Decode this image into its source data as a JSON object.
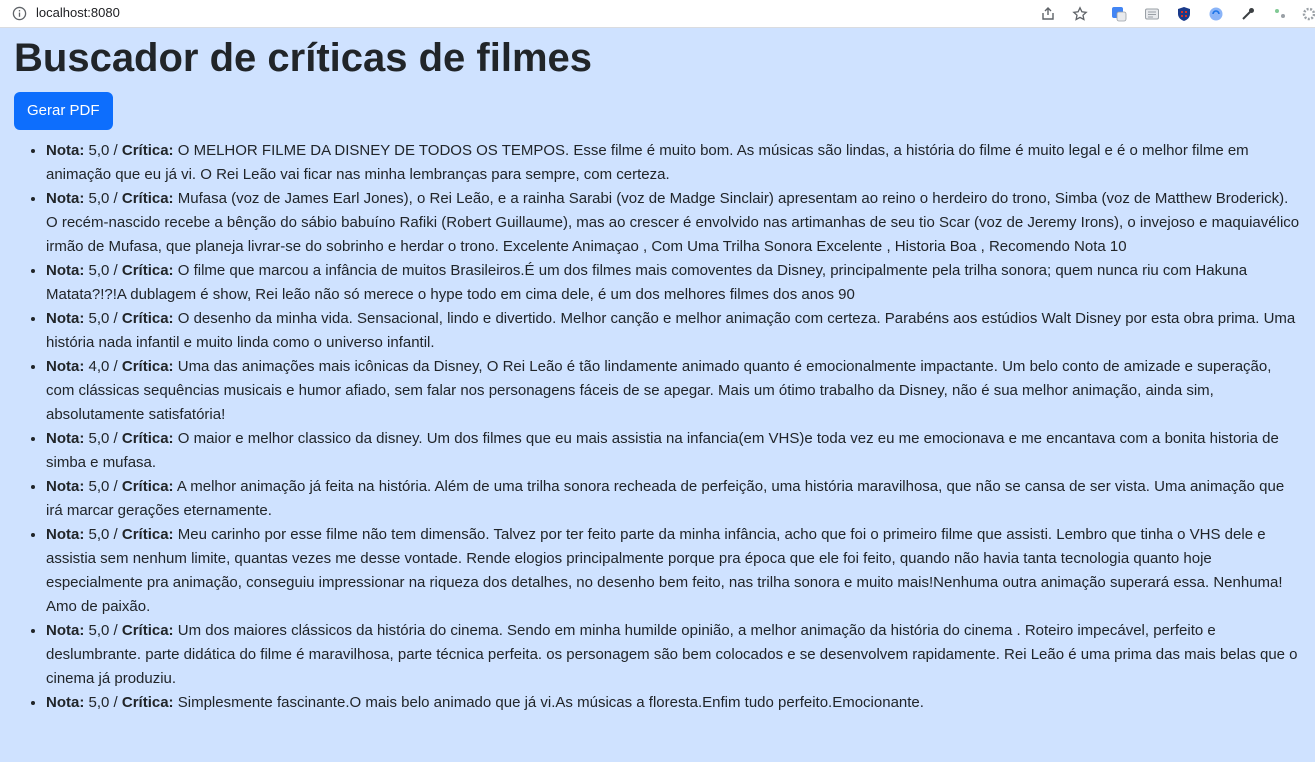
{
  "browser": {
    "url": "localhost:8080"
  },
  "page": {
    "title": "Buscador de críticas de filmes",
    "pdf_button_label": "Gerar PDF"
  },
  "labels": {
    "nota": "Nota:",
    "critica": "Crítica:",
    "separator": " / "
  },
  "reviews": [
    {
      "nota": "5,0",
      "critica": "O MELHOR FILME DA DISNEY DE TODOS OS TEMPOS. Esse filme é muito bom. As músicas são lindas, a história do filme é muito legal e é o melhor filme em animação que eu já vi. O Rei Leão vai ficar nas minha lembranças para sempre, com certeza."
    },
    {
      "nota": "5,0",
      "critica": "Mufasa (voz de James Earl Jones), o Rei Leão, e a rainha Sarabi (voz de Madge Sinclair) apresentam ao reino o herdeiro do trono, Simba (voz de Matthew Broderick). O recém-nascido recebe a bênção do sábio babuíno Rafiki (Robert Guillaume), mas ao crescer é envolvido nas artimanhas de seu tio Scar (voz de Jeremy Irons), o invejoso e maquiavélico irmão de Mufasa, que planeja livrar-se do sobrinho e herdar o trono. Excelente Animaçao , Com Uma Trilha Sonora Excelente , Historia Boa , Recomendo Nota 10"
    },
    {
      "nota": "5,0",
      "critica": "O filme que marcou a infância de muitos Brasileiros.É um dos filmes mais comoventes da Disney, principalmente pela trilha sonora; quem nunca riu com Hakuna Matata?!?!A dublagem é show, Rei leão não só merece o hype todo em cima dele, é um dos melhores filmes dos anos 90"
    },
    {
      "nota": "5,0",
      "critica": "O desenho da minha vida. Sensacional, lindo e divertido. Melhor canção e melhor animação com certeza. Parabéns aos estúdios Walt Disney por esta obra prima. Uma história nada infantil e muito linda como o universo infantil."
    },
    {
      "nota": "4,0",
      "critica": "Uma das animações mais icônicas da Disney, O Rei Leão é tão lindamente animado quanto é emocionalmente impactante. Um belo conto de amizade e superação, com clássicas sequências musicais e humor afiado, sem falar nos personagens fáceis de se apegar. Mais um ótimo trabalho da Disney, não é sua melhor animação, ainda sim, absolutamente satisfatória!"
    },
    {
      "nota": "5,0",
      "critica": "O maior e melhor classico da disney. Um dos filmes que eu mais assistia na infancia(em VHS)e toda vez eu me emocionava e me encantava com a bonita historia de simba e mufasa."
    },
    {
      "nota": "5,0",
      "critica": "A melhor animação já feita na história. Além de uma trilha sonora recheada de perfeição, uma história maravilhosa, que não se cansa de ser vista. Uma animação que irá marcar gerações eternamente."
    },
    {
      "nota": "5,0",
      "critica": "Meu carinho por esse filme não tem dimensão. Talvez por ter feito parte da minha infância, acho que foi o primeiro filme que assisti. Lembro que tinha o VHS dele e assistia sem nenhum limite, quantas vezes me desse vontade. Rende elogios principalmente porque pra época que ele foi feito, quando não havia tanta tecnologia quanto hoje especialmente pra animação, conseguiu impressionar na riqueza dos detalhes, no desenho bem feito, nas trilha sonora e muito mais!Nenhuma outra animação superará essa. Nenhuma! Amo de paixão."
    },
    {
      "nota": "5,0",
      "critica": "Um dos maiores clássicos da história do cinema. Sendo em minha humilde opinião, a melhor animação da história do cinema . Roteiro impecável, perfeito e deslumbrante. parte didática do filme é maravilhosa, parte técnica perfeita. os personagem são bem colocados e se desenvolvem rapidamente. Rei Leão é uma prima das mais belas que o cinema já produziu."
    },
    {
      "nota": "5,0",
      "critica": "Simplesmente fascinante.O mais belo animado que já vi.As músicas a floresta.Enfim tudo perfeito.Emocionante."
    }
  ]
}
